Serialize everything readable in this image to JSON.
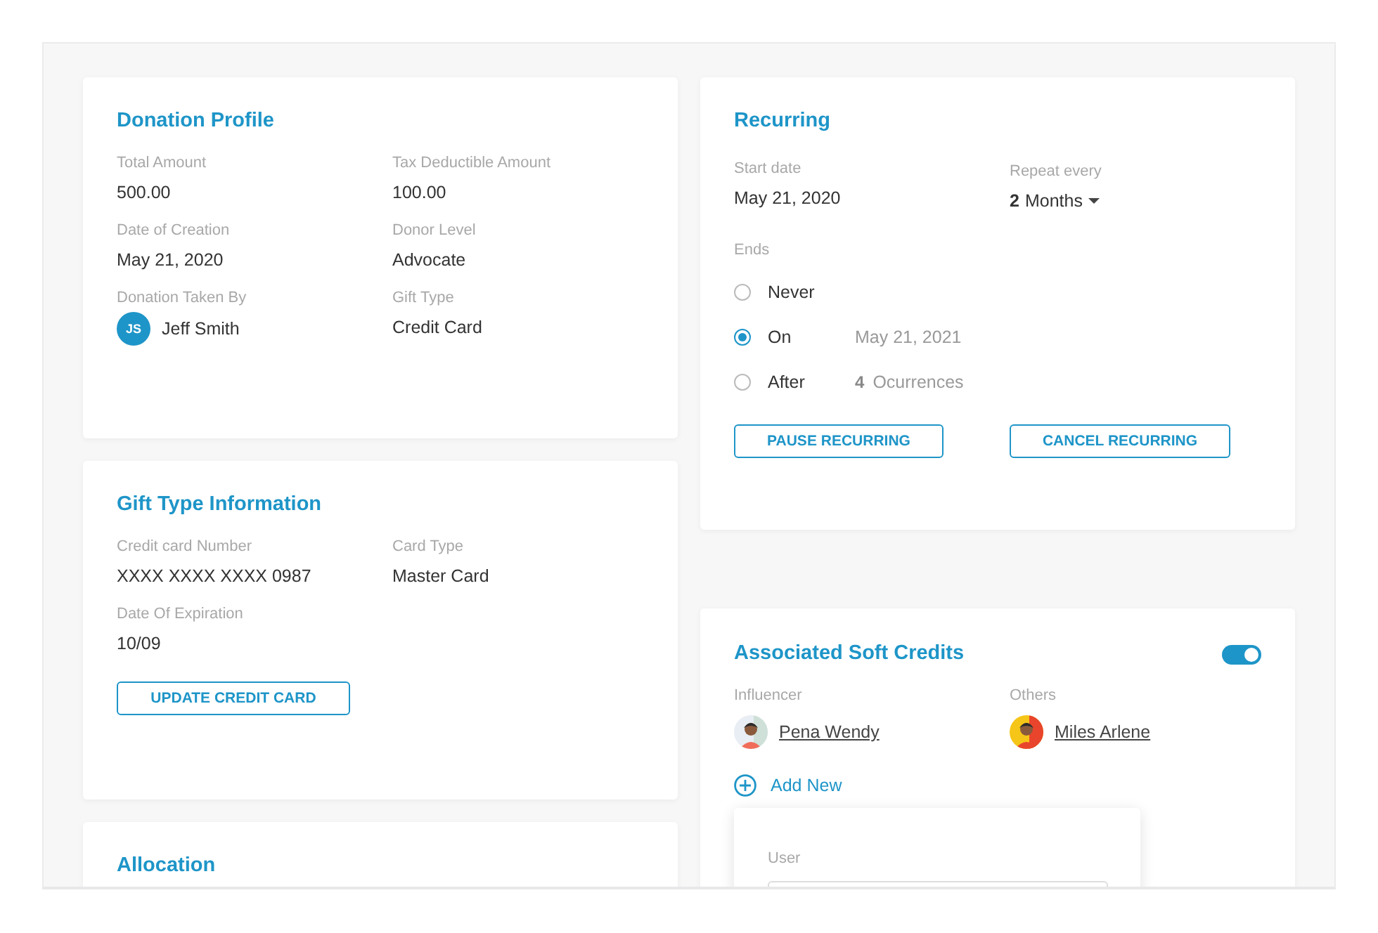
{
  "donation_profile": {
    "title": "Donation Profile",
    "fields": [
      {
        "kind": "text",
        "label": "Total Amount",
        "value": "500.00"
      },
      {
        "kind": "text",
        "label": "Tax Deductible Amount",
        "value": "100.00"
      },
      {
        "kind": "text",
        "label": "Date of Creation",
        "value": "May 21, 2020"
      },
      {
        "kind": "text",
        "label": "Donor Level",
        "value": "Advocate"
      },
      {
        "kind": "person",
        "label": "Donation Taken By",
        "initials": "JS",
        "value": "Jeff Smith"
      },
      {
        "kind": "text",
        "label": "Gift Type",
        "value": "Credit Card"
      }
    ]
  },
  "gift_type_information": {
    "title": "Gift Type Information",
    "fields": [
      {
        "kind": "text",
        "label": "Credit card Number",
        "value": "XXXX XXXX XXXX 0987"
      },
      {
        "kind": "text",
        "label": "Card Type",
        "value": "Master Card"
      },
      {
        "kind": "text",
        "label": "Date Of Expiration",
        "value": "10/09"
      }
    ],
    "button": "UPDATE CREDIT CARD"
  },
  "allocation": {
    "title": "Allocation"
  },
  "recurring": {
    "title": "Recurring",
    "start_date": {
      "label": "Start date",
      "value": "May 21, 2020"
    },
    "repeat_every": {
      "label": "Repeat every",
      "count": "2",
      "unit": "Months"
    },
    "ends": {
      "label": "Ends",
      "options": [
        {
          "label": "Never",
          "selected": false
        },
        {
          "label": "On",
          "selected": true,
          "kind": "date",
          "detail": "May 21, 2021"
        },
        {
          "label": "After",
          "selected": false,
          "kind": "count",
          "count": "4",
          "detail": "Ocurrences"
        }
      ]
    },
    "buttons": [
      "PAUSE RECURRING",
      "CANCEL RECURRING"
    ]
  },
  "soft_credits": {
    "title": "Associated Soft Credits",
    "on": true,
    "people": [
      {
        "label": "Influencer",
        "name": "Pena Wendy"
      },
      {
        "label": "Others",
        "name": "Miles Arlene"
      }
    ],
    "add_new": "Add New",
    "popup": {
      "label": "User"
    }
  }
}
